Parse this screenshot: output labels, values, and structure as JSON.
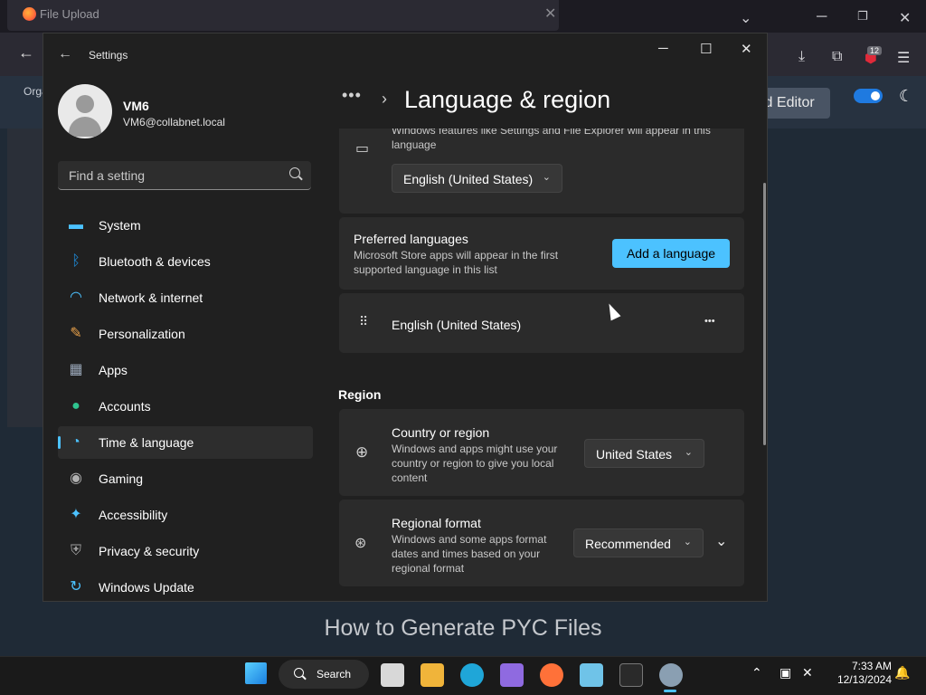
{
  "browser": {
    "tab_title": "File Upload",
    "sub_text": "Orga",
    "editor_button": "ld Editor",
    "badge_count": "12",
    "headline": "How to Generate PYC Files"
  },
  "settings": {
    "window_title": "Settings",
    "user": {
      "name": "VM6",
      "email": "VM6@collabnet.local"
    },
    "search": {
      "placeholder": "Find a setting"
    },
    "nav": [
      {
        "label": "System",
        "icon": "monitor-icon",
        "color": "#4cc2ff"
      },
      {
        "label": "Bluetooth & devices",
        "icon": "bluetooth-icon",
        "color": "#1f8fe0"
      },
      {
        "label": "Network & internet",
        "icon": "wifi-icon",
        "color": "#4cc2ff"
      },
      {
        "label": "Personalization",
        "icon": "brush-icon",
        "color": "#e8a14a"
      },
      {
        "label": "Apps",
        "icon": "apps-icon",
        "color": "#9aa7b8"
      },
      {
        "label": "Accounts",
        "icon": "person-icon",
        "color": "#2fc48f"
      },
      {
        "label": "Time & language",
        "icon": "globe-clock-icon",
        "color": "#4cc2ff"
      },
      {
        "label": "Gaming",
        "icon": "gamepad-icon",
        "color": "#b0b0b0"
      },
      {
        "label": "Accessibility",
        "icon": "accessibility-icon",
        "color": "#4cc2ff"
      },
      {
        "label": "Privacy & security",
        "icon": "shield-icon",
        "color": "#a0a0a0"
      },
      {
        "label": "Windows Update",
        "icon": "sync-icon",
        "color": "#4cc2ff"
      }
    ],
    "active_nav": "Time & language",
    "breadcrumb": {
      "dots": "•••",
      "chevron": "›",
      "page_title": "Language & region"
    },
    "display_language": {
      "partial_text": "Windows features like Settings and File Explorer will appear in this",
      "partial_text2": "language",
      "value": "English (United States)"
    },
    "preferred": {
      "title": "Preferred languages",
      "desc1": "Microsoft Store apps will appear in the first",
      "desc2": "supported language in this list",
      "add_button": "Add a language",
      "language": "English (United States)",
      "more": "•••"
    },
    "region": {
      "section_label": "Region",
      "country": {
        "title": "Country or region",
        "desc1": "Windows and apps might use your",
        "desc2": "country or region to give you local",
        "desc3": "content",
        "value": "United States"
      },
      "format": {
        "title": "Regional format",
        "desc1": "Windows and some apps format",
        "desc2": "dates and times based on your",
        "desc3": "regional format",
        "value": "Recommended"
      }
    }
  },
  "taskbar": {
    "search_label": "Search",
    "time": "7:33 AM",
    "date": "12/13/2024"
  }
}
